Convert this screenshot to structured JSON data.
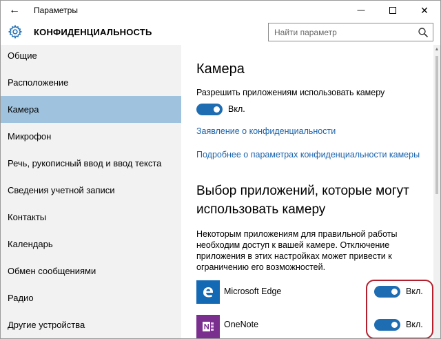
{
  "window": {
    "title": "Параметры",
    "back_glyph": "←",
    "minimize_glyph": "—",
    "close_glyph": "✕"
  },
  "header": {
    "title": "КОНФИДЕНЦИАЛЬНОСТЬ",
    "icon": "gear-icon",
    "search_placeholder": "Найти параметр"
  },
  "sidebar": {
    "active_index": 2,
    "items": [
      {
        "label": "Общие"
      },
      {
        "label": "Расположение"
      },
      {
        "label": "Камера"
      },
      {
        "label": "Микрофон"
      },
      {
        "label": "Речь, рукописный ввод и ввод текста"
      },
      {
        "label": "Сведения учетной записи"
      },
      {
        "label": "Контакты"
      },
      {
        "label": "Календарь"
      },
      {
        "label": "Обмен сообщениями"
      },
      {
        "label": "Радио"
      },
      {
        "label": "Другие устройства"
      }
    ]
  },
  "main": {
    "heading": "Камера",
    "allow_label": "Разрешить приложениям использовать камеру",
    "allow_toggle": {
      "state": "on",
      "label": "Вкл."
    },
    "privacy_link": "Заявление о конфиденциальности",
    "more_link": "Подробнее о параметрах конфиденциальности камеры",
    "apps_heading": "Выбор приложений, которые могут использовать камеру",
    "apps_description": "Некоторым приложениям для правильной работы необходим доступ к вашей камере. Отключение приложения в этих настройках может привести к ограничению его возможностей.",
    "apps": [
      {
        "name": "Microsoft Edge",
        "toggle_label": "Вкл.",
        "state": "on",
        "icon": "edge-icon",
        "tile_color": "#1469b5"
      },
      {
        "name": "OneNote",
        "toggle_label": "Вкл.",
        "state": "on",
        "icon": "onenote-icon",
        "tile_color": "#7a2f8f"
      }
    ]
  },
  "colors": {
    "accent": "#1e6db3",
    "link": "#1a63ad",
    "sidebar_active": "#9fc2de",
    "sidebar_bg": "#f2f2f2",
    "annotation": "#b21f2d"
  }
}
